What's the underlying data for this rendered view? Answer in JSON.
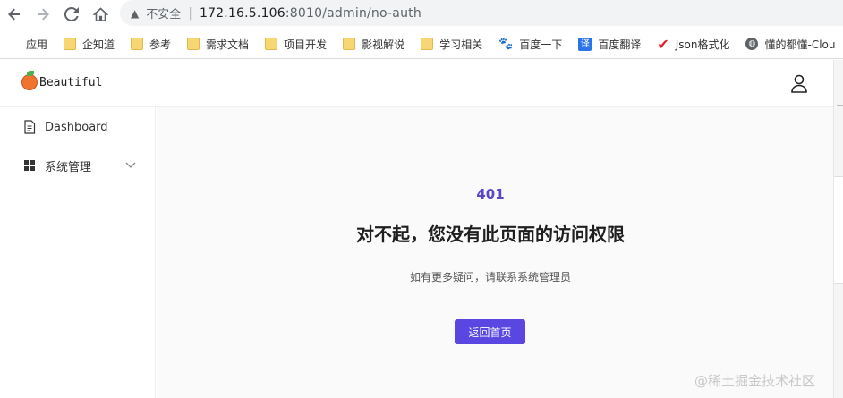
{
  "browser": {
    "insecure_label": "不安全",
    "url_host": "172.16.5.106",
    "url_path": ":8010/admin/no-auth",
    "bookmarks": [
      {
        "label": "应用",
        "icon": "apps-icon"
      },
      {
        "label": "企知道",
        "icon": "folder-icon"
      },
      {
        "label": "参考",
        "icon": "folder-icon"
      },
      {
        "label": "需求文档",
        "icon": "folder-icon"
      },
      {
        "label": "项目开发",
        "icon": "folder-icon"
      },
      {
        "label": "影视解说",
        "icon": "folder-icon"
      },
      {
        "label": "学习相关",
        "icon": "folder-icon"
      },
      {
        "label": "百度一下",
        "icon": "baidu-icon"
      },
      {
        "label": "百度翻译",
        "icon": "fanyi-icon"
      },
      {
        "label": "Json格式化",
        "icon": "check-icon"
      },
      {
        "label": "懂的都懂-Clou",
        "icon": "globe-icon"
      }
    ],
    "fanyi_glyph": "译"
  },
  "header": {
    "logo_text": "Beautiful",
    "user_icon": "user-icon"
  },
  "sidebar": {
    "items": [
      {
        "label": "Dashboard",
        "icon": "document-icon"
      },
      {
        "label": "系统管理",
        "icon": "grid-icon"
      }
    ]
  },
  "error": {
    "code": "401",
    "title": "对不起，您没有此页面的访问权限",
    "description": "如有更多疑问，请联系系统管理员",
    "button_label": "返回首页"
  },
  "watermark": "@稀土掘金技术社区",
  "colors": {
    "accent": "#5a46e0",
    "code_color": "#5b48c8"
  }
}
